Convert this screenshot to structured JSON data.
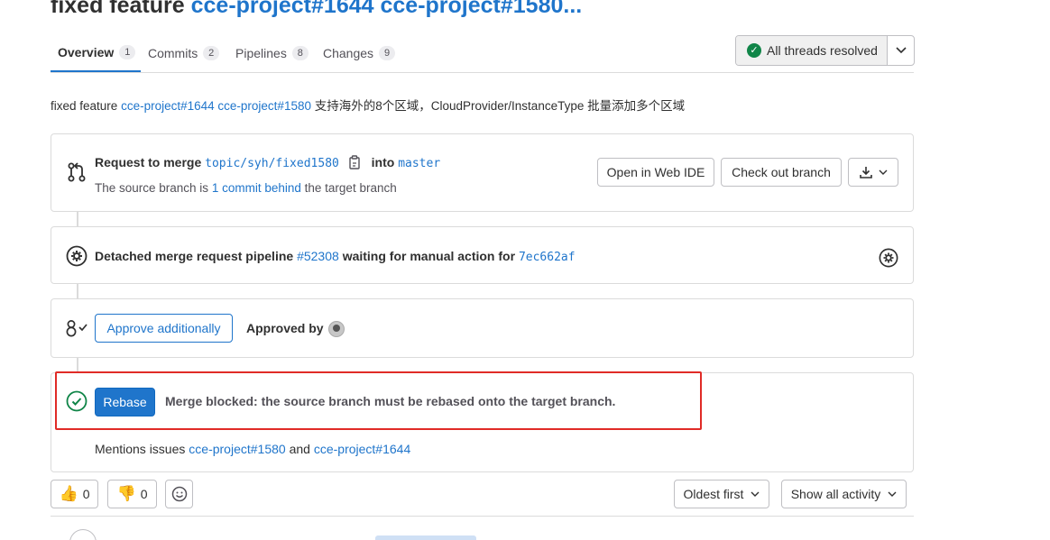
{
  "header": {
    "title_prefix": "fixed feature",
    "title_links": "cce-project#1644 cce-project#1580..."
  },
  "tabs": [
    {
      "label": "Overview",
      "count": "1"
    },
    {
      "label": "Commits",
      "count": "2"
    },
    {
      "label": "Pipelines",
      "count": "8"
    },
    {
      "label": "Changes",
      "count": "9"
    }
  ],
  "threads": {
    "label": "All threads resolved"
  },
  "description": {
    "prefix": "fixed feature",
    "link1": "cce-project#1644",
    "link2": "cce-project#1580",
    "suffix": "支持海外的8个区域，CloudProvider/InstanceType 批量添加多个区域"
  },
  "merge_request": {
    "request_label": "Request to merge",
    "source_branch": "topic/syh/fixed1580",
    "into_label": "into",
    "target_branch": "master",
    "status_prefix": "The source branch is",
    "behind_link": "1 commit behind",
    "status_suffix": "the target branch",
    "open_web_ide": "Open in Web IDE",
    "check_out_branch": "Check out branch"
  },
  "pipeline": {
    "prefix": "Detached merge request pipeline",
    "pipeline_id": "#52308",
    "middle": "waiting for manual action for",
    "commit": "7ec662af"
  },
  "approval": {
    "approve_button": "Approve additionally",
    "approved_by": "Approved by"
  },
  "rebase": {
    "button": "Rebase",
    "message": "Merge blocked: the source branch must be rebased onto the target branch."
  },
  "mentions": {
    "prefix": "Mentions issues",
    "issue1": "cce-project#1580",
    "and": "and",
    "issue2": "cce-project#1644"
  },
  "reactions": {
    "thumbs_up": "0",
    "thumbs_down": "0"
  },
  "sort": {
    "label": "Oldest first"
  },
  "filter": {
    "label": "Show all activity"
  },
  "colors": {
    "link": "#1f75cb",
    "success": "#108548",
    "highlight": "#e02b27"
  }
}
